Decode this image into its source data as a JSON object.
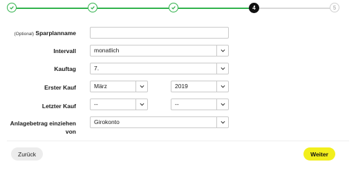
{
  "stepper": {
    "steps": [
      {
        "label": "",
        "state": "done",
        "icon": "check-icon"
      },
      {
        "label": "",
        "state": "done",
        "icon": "check-icon"
      },
      {
        "label": "",
        "state": "done",
        "icon": "check-icon"
      },
      {
        "label": "4",
        "state": "current"
      },
      {
        "label": "5",
        "state": "todo"
      }
    ],
    "colors": {
      "done": "#2fb14a",
      "current": "#111111",
      "todo": "#cfcfcf"
    }
  },
  "form": {
    "sparplanname": {
      "optional_label": "(Optional)",
      "label": "Sparplanname",
      "value": ""
    },
    "intervall": {
      "label": "Intervall",
      "value": "monatlich"
    },
    "kauftag": {
      "label": "Kauftag",
      "value": "7."
    },
    "erster_kauf": {
      "label": "Erster Kauf",
      "month": "März",
      "year": "2019"
    },
    "letzter_kauf": {
      "label": "Letzter Kauf",
      "month": "--",
      "year": "--"
    },
    "anlagebetrag": {
      "label_line1": "Anlagebetrag einziehen",
      "label_line2": "von",
      "value": "Girokonto"
    }
  },
  "footer": {
    "back_label": "Zurück",
    "next_label": "Weiter",
    "next_color": "#f2ef1c"
  }
}
